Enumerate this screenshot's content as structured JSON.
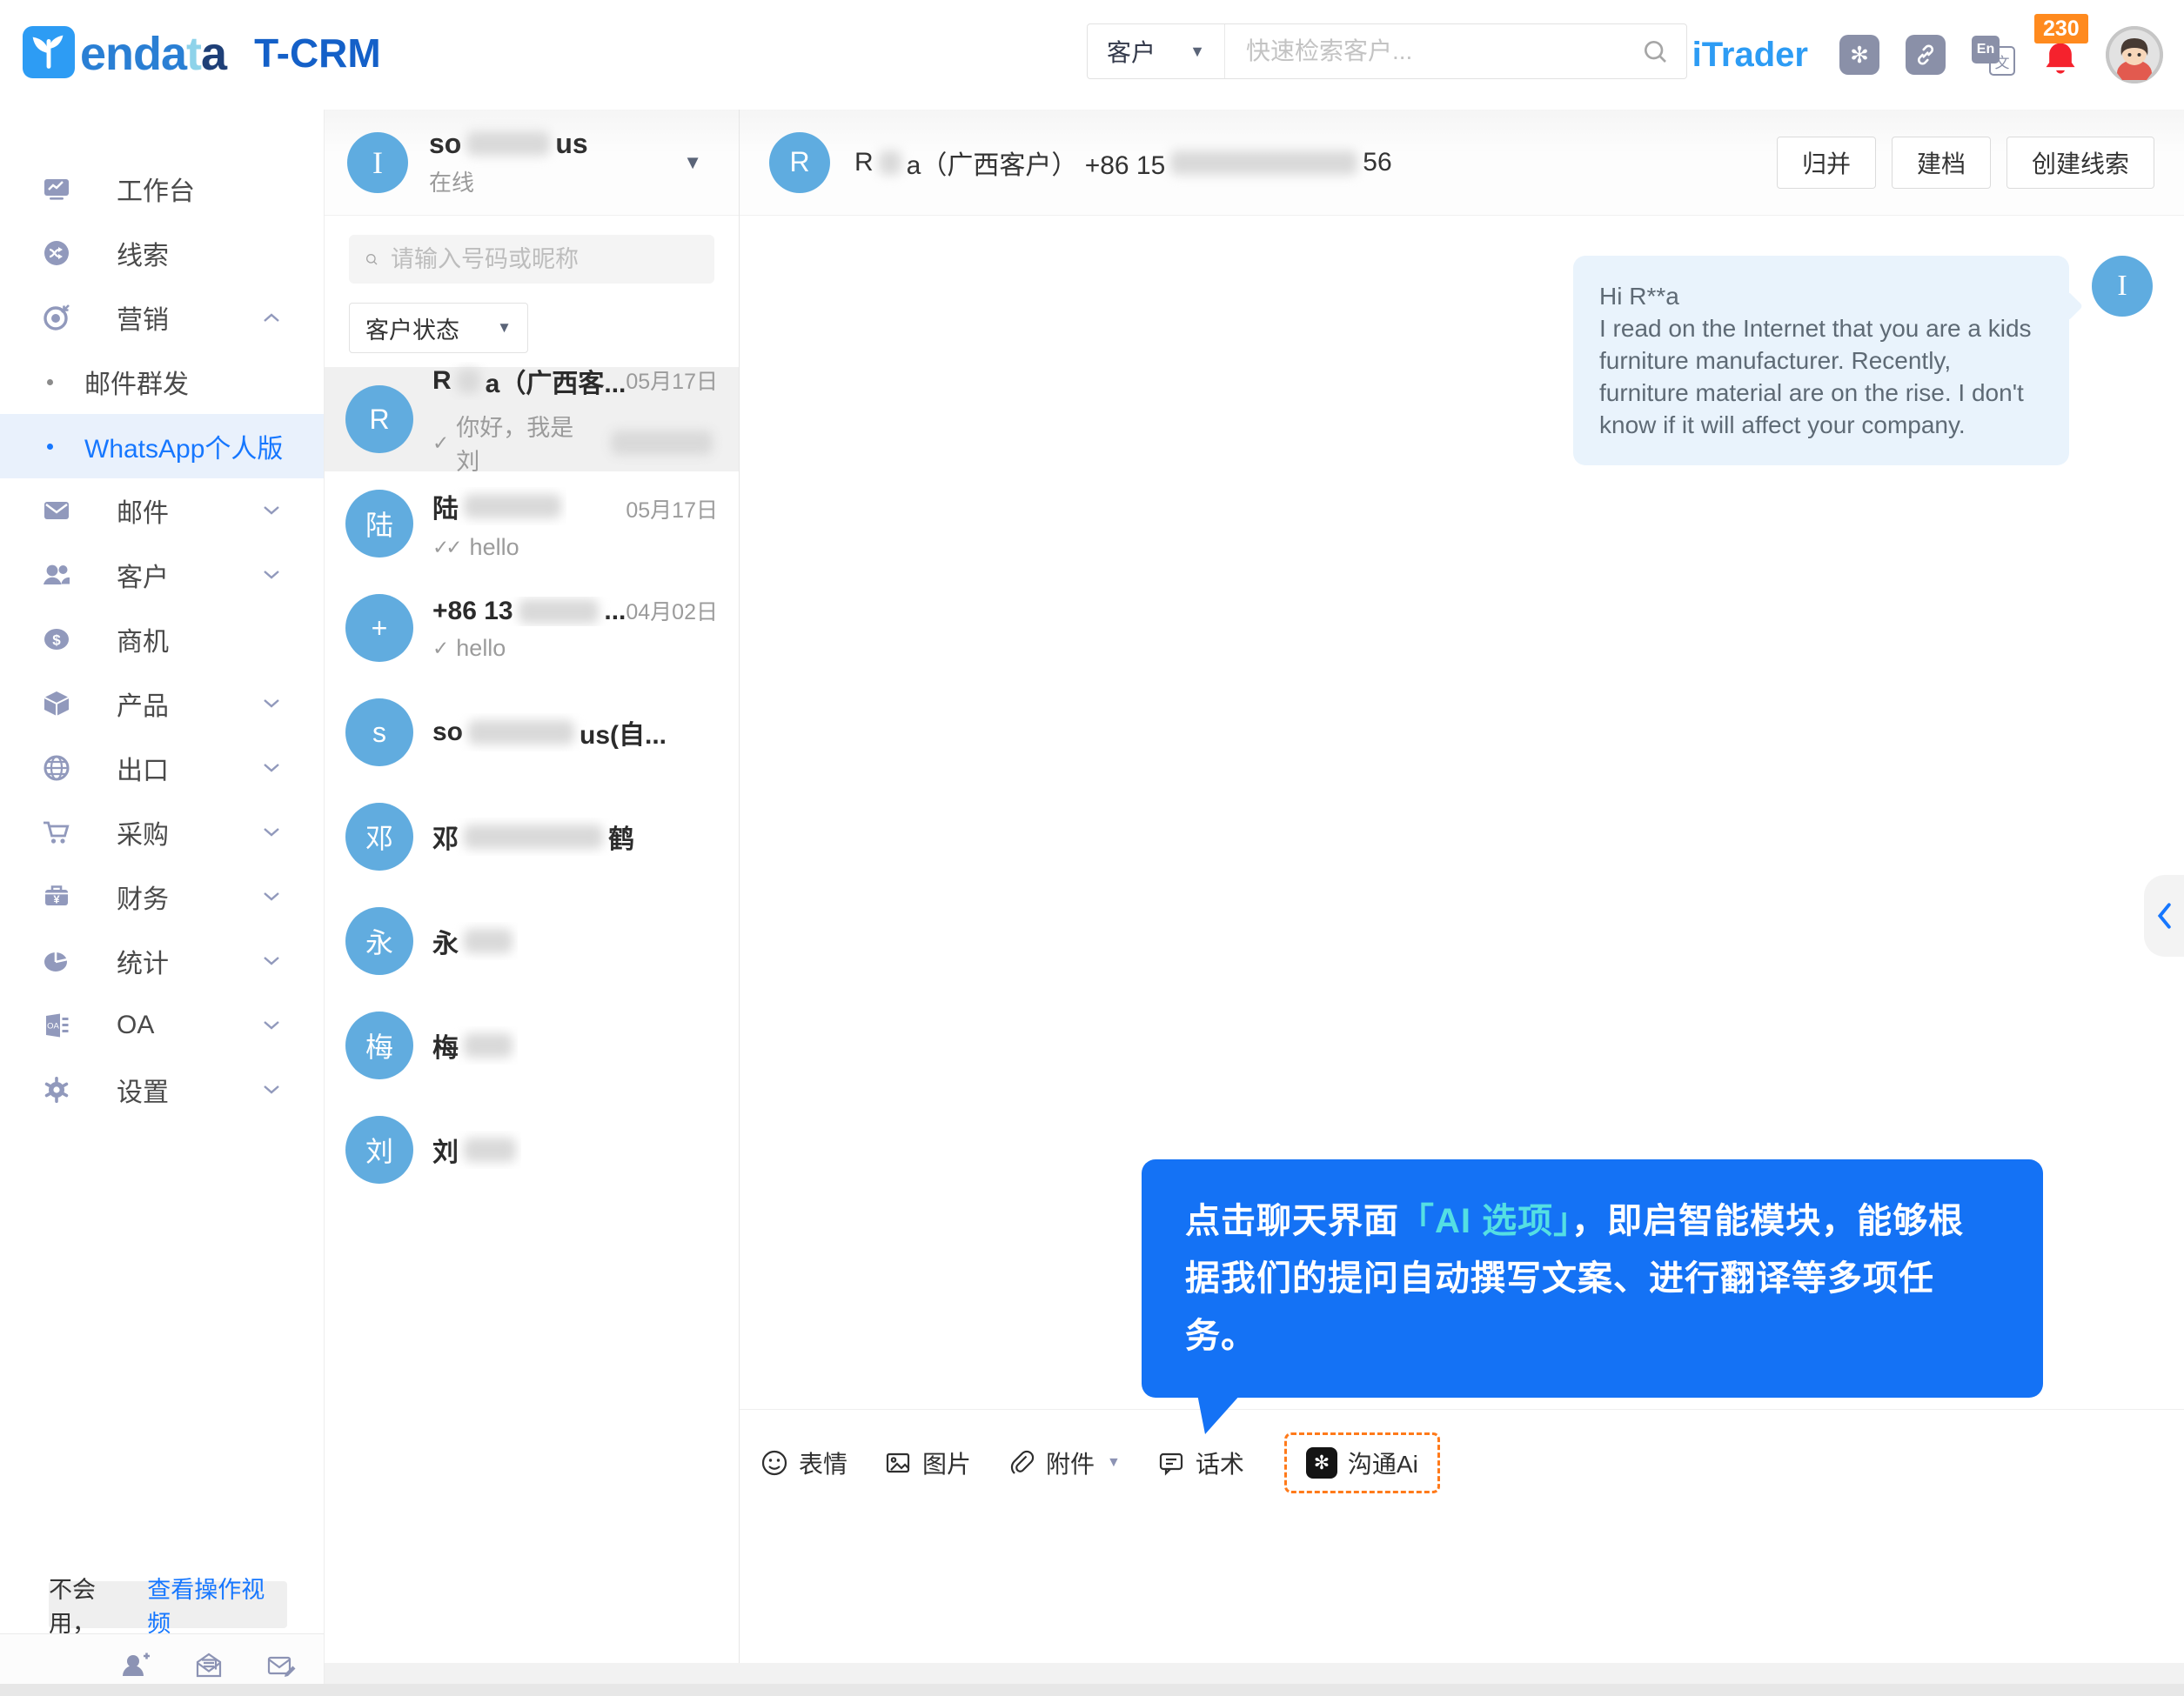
{
  "brand": {
    "logo_word_blue": "enda",
    "logo_word_cyan": "t",
    "logo_word_dark": "a",
    "product_name": "T-CRM",
    "right_brand": "iTrader"
  },
  "header": {
    "search_category": "客户",
    "search_placeholder": "快速检索客户...",
    "notification_count": "230"
  },
  "sidebar": {
    "items": [
      {
        "label": "工作台"
      },
      {
        "label": "线索"
      },
      {
        "label": "营销"
      },
      {
        "label": "邮件"
      },
      {
        "label": "客户"
      },
      {
        "label": "商机"
      },
      {
        "label": "产品"
      },
      {
        "label": "出口"
      },
      {
        "label": "采购"
      },
      {
        "label": "财务"
      },
      {
        "label": "统计"
      },
      {
        "label": "OA"
      },
      {
        "label": "设置"
      }
    ],
    "submenu": [
      {
        "label": "邮件群发"
      },
      {
        "label": "WhatsApp个人版"
      }
    ],
    "help_text": "不会用，",
    "help_link": "查看操作视频"
  },
  "contacts": {
    "user_initial": "I",
    "user_name_pre": "so",
    "user_name_post": "us",
    "user_status": "在线",
    "search_placeholder": "请输入号码或昵称",
    "filter_label": "客户状态",
    "list": [
      {
        "initial": "R",
        "name_pre": "R",
        "name_post": "a（广西客...",
        "date": "05月17日",
        "check": "✓",
        "msg": "你好，我是刘"
      },
      {
        "initial": "陆",
        "name_pre": "陆",
        "name_post": "",
        "date": "05月17日",
        "check": "✓✓",
        "msg": "hello"
      },
      {
        "initial": "+",
        "name_pre": "+86 13",
        "name_post": "...",
        "date": "04月02日",
        "check": "✓",
        "msg": "hello"
      },
      {
        "initial": "s",
        "name_pre": "so",
        "name_post": "us(自..."
      },
      {
        "initial": "邓",
        "name_pre": "邓",
        "name_post": "鹤"
      },
      {
        "initial": "永",
        "name_pre": "永",
        "name_post": ""
      },
      {
        "initial": "梅",
        "name_pre": "梅",
        "name_post": ""
      },
      {
        "initial": "刘",
        "name_pre": "刘",
        "name_post": ""
      }
    ]
  },
  "chat": {
    "peer_initial": "R",
    "title_pre": "R",
    "title_mid": "a（广西客户） +86 15",
    "title_post": "56",
    "actions": [
      {
        "label": "归并"
      },
      {
        "label": "建档"
      },
      {
        "label": "创建线索"
      }
    ],
    "message_greeting": "Hi R**a",
    "message_body": "I read on the Internet that you are a kids furniture manufacturer. Recently, furniture material are on the rise. I don't know if it will affect your company.",
    "message_avatar_initial": "I",
    "tooltip_pre": "点击聊天界面",
    "tooltip_highlight": "「AI 选项」",
    "tooltip_post": "，即启智能模块，能够根据我们的提问自动撰写文案、进行翻译等多项任务。",
    "toolbar": [
      {
        "label": "表情"
      },
      {
        "label": "图片"
      },
      {
        "label": "附件"
      },
      {
        "label": "话术"
      },
      {
        "label": "沟通Ai"
      }
    ]
  },
  "colors": {
    "accent_blue": "#1677FF",
    "tooltip_blue": "#1472F5",
    "tooltip_highlight_cyan": "#54DFE3",
    "avatar_blue": "#5FACE0",
    "badge_orange": "#FF8A1E",
    "bell_red": "#F5222D",
    "dashed_orange": "#FF7A1A"
  }
}
